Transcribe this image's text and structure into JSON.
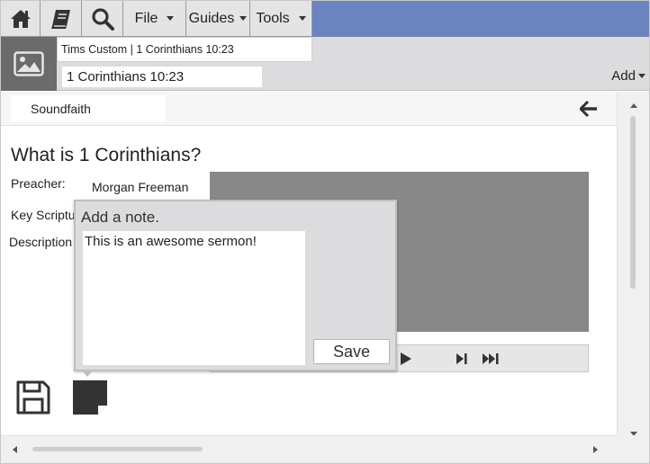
{
  "toolbar": {
    "menus": [
      {
        "label": "File"
      },
      {
        "label": "Guides"
      },
      {
        "label": "Tools"
      }
    ],
    "accent": "#6b84bf"
  },
  "header": {
    "breadcrumb": "Tims Custom | 1 Corinthians 10:23",
    "reference": "1 Corinthians  10:23",
    "add_label": "Add"
  },
  "tab": {
    "label": "Soundfaith"
  },
  "sermon": {
    "title": "What is 1 Corinthians?",
    "preacher_label": "Preacher:",
    "preacher_value": "Morgan Freeman",
    "scripture_label": "Key Scriptu",
    "description_label": "Description"
  },
  "note_popup": {
    "title": "Add a note.",
    "text": "This is an awesome sermon!",
    "save_label": "Save"
  },
  "icons": [
    "home-icon",
    "book-icon",
    "search-icon",
    "image-icon",
    "back-arrow-icon",
    "play-icon",
    "next-icon",
    "fast-forward-icon",
    "save-icon",
    "note-icon"
  ]
}
